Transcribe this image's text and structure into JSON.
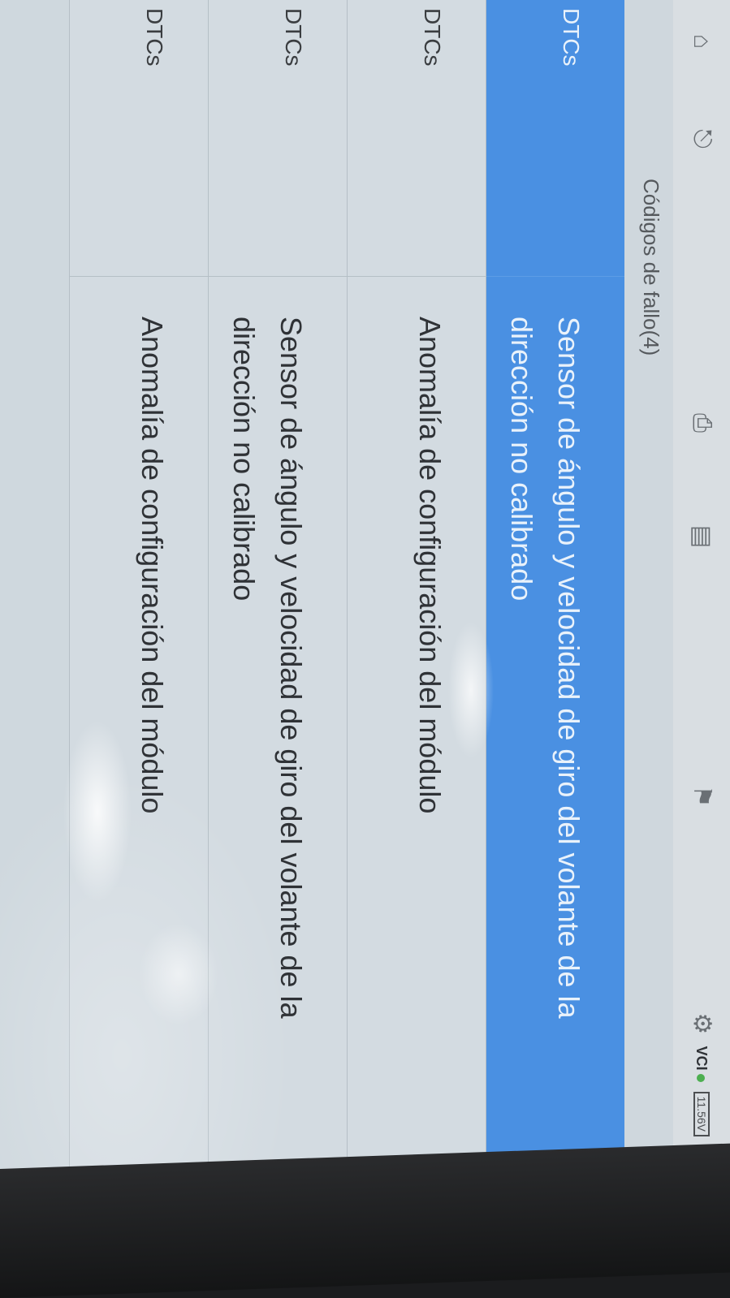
{
  "toolbar": {
    "icons": [
      "home-icon",
      "back-icon",
      "print-icon",
      "report-icon",
      "refresh-icon",
      "settings-icon"
    ]
  },
  "status": {
    "vci_label": "VCI",
    "battery_label": "11.56V"
  },
  "header": {
    "title": "Códigos de fallo(4)"
  },
  "rows": [
    {
      "code": "DTCs",
      "description": "Sensor de ángulo y velocidad de giro del volante de la dirección no calibrado",
      "selected": true
    },
    {
      "code": "DTCs",
      "description": "Anomalía de configuración del módulo",
      "selected": false
    },
    {
      "code": "DTCs",
      "description": "Sensor de ángulo y velocidad de giro del volante de la dirección no calibrado",
      "selected": false
    },
    {
      "code": "DTCs",
      "description": "Anomalía de configuración del módulo",
      "selected": false
    }
  ],
  "colors": {
    "selected_row": "#4a90e2",
    "row_bg": "#d3dbe1",
    "toolbar_bg": "#d9dee2"
  }
}
